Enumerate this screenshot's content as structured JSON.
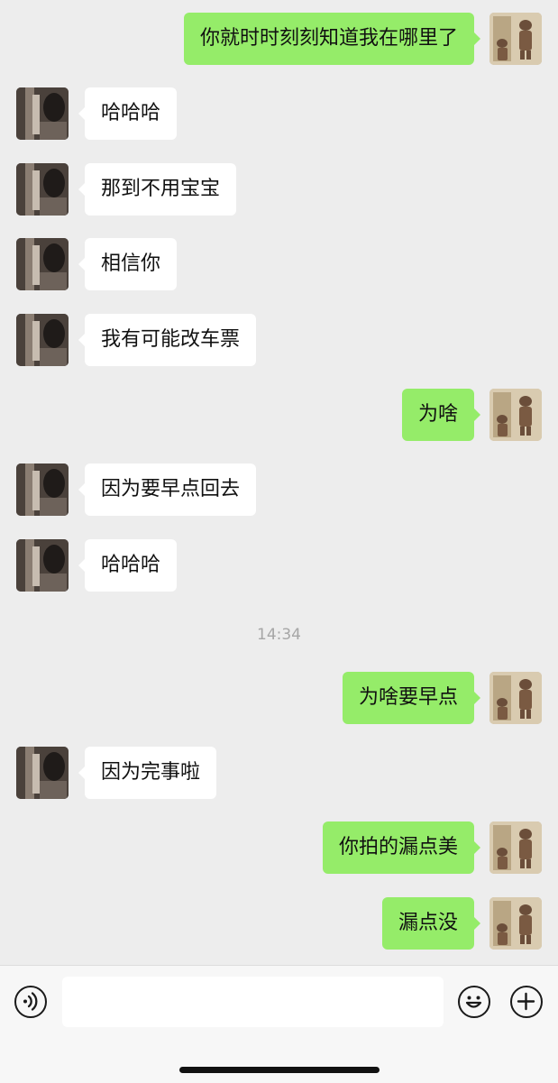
{
  "messages": [
    {
      "side": "self",
      "text": "你就时时刻刻知道我在哪里了"
    },
    {
      "side": "other",
      "text": "哈哈哈"
    },
    {
      "side": "other",
      "text": "那到不用宝宝"
    },
    {
      "side": "other",
      "text": "相信你"
    },
    {
      "side": "other",
      "text": "我有可能改车票"
    },
    {
      "side": "self",
      "text": "为啥"
    },
    {
      "side": "other",
      "text": "因为要早点回去"
    },
    {
      "side": "other",
      "text": "哈哈哈"
    },
    {
      "side": "self",
      "text": "为啥要早点"
    },
    {
      "side": "other",
      "text": "因为完事啦"
    },
    {
      "side": "self",
      "text": "你拍的漏点美"
    },
    {
      "side": "self",
      "text": "漏点没"
    }
  ],
  "timestamp": "14:34",
  "input": {
    "value": "",
    "placeholder": ""
  },
  "icons": {
    "voice": "voice-icon",
    "emoji": "emoji-icon",
    "plus": "plus-icon"
  },
  "colors": {
    "background": "#ededed",
    "self_bubble": "#95ec69",
    "other_bubble": "#ffffff",
    "timestamp": "#a6a6a6"
  }
}
